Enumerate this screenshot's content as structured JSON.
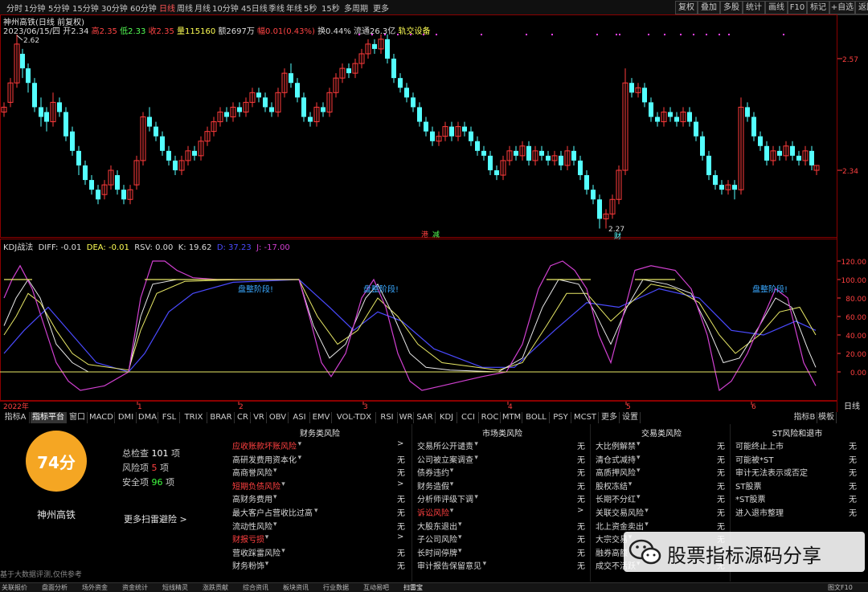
{
  "periods": [
    "分时",
    "1分钟",
    "5分钟",
    "15分钟",
    "30分钟",
    "60分钟",
    "日线",
    "周线",
    "月线",
    "10分钟",
    "45日线",
    "季线",
    "年线",
    "5秒",
    "15秒",
    "多周期",
    "更多"
  ],
  "active_period": "日线",
  "toolbar": [
    "复权",
    "叠加",
    "多股",
    "统计",
    "画线",
    "F10",
    "标记",
    "+自选",
    "返回"
  ],
  "stock": {
    "title": "神州高铁(日线 前复权)",
    "info_date": "2023/06/15/四",
    "open": "开2.34",
    "high": "高2.35",
    "low": "低2.33",
    "close": "收2.35",
    "volume": "量115160",
    "amount": "额2697万",
    "change": "幅0.01(0.43%)",
    "turnover": "换0.44%",
    "float": "流通26.3亿",
    "sector": "轨交设备"
  },
  "price_axis": {
    "upper": "2.57",
    "lower": "2.34"
  },
  "price_annotations": {
    "high": "2.62",
    "low": "2.27",
    "low_note": "财"
  },
  "chart_marks": {
    "m1": "港",
    "m2": "减"
  },
  "kdj": {
    "title": "KDJ战法",
    "diff": "DIFF: -0.01",
    "dea": "DEA: -0.01",
    "rsv": "RSV: 0.00",
    "k": "K: 19.62",
    "d": "D: 37.23",
    "j": "J: -17.00",
    "axis_labels": [
      "120.00",
      "100.00",
      "80.00",
      "60.00",
      "40.00",
      "20.00",
      "0.00"
    ],
    "note": "盘整阶段!"
  },
  "xaxis": {
    "year": "2022年",
    "months": [
      "1",
      "2",
      "3",
      "4",
      "5",
      "6"
    ],
    "period_label": "日线"
  },
  "indicator_tabs": [
    "指标A",
    "指标平台",
    "窗口",
    "MACD",
    "DMI",
    "DMA",
    "FSL",
    "TRIX",
    "BRAR",
    "CR",
    "VR",
    "OBV",
    "ASI",
    "EMV",
    "VOL-TDX",
    "RSI",
    "WR",
    "SAR",
    "KDJ",
    "CCI",
    "ROC",
    "MTM",
    "BOLL",
    "PSY",
    "MCST",
    "更多",
    "设置"
  ],
  "right_tabs": [
    "指标B",
    "模板"
  ],
  "risk": {
    "score": "74分",
    "name": "神州高铁",
    "total_label": "总检查",
    "total_value": "101",
    "total_unit": "项",
    "risk_label": "风险项",
    "risk_value": "5",
    "risk_unit": "项",
    "safe_label": "安全项",
    "safe_value": "96",
    "safe_unit": "项",
    "more": "更多扫雷避险 >",
    "disclaimer": "基于大数据评测,仅供参考",
    "columns": [
      {
        "title": "财务类风险",
        "items": [
          {
            "label": "应收账款坏账风险",
            "value": ">",
            "warn": true
          },
          {
            "label": "高研发费用资本化",
            "value": "无",
            "warn": false
          },
          {
            "label": "高商誉风险",
            "value": "无",
            "warn": false
          },
          {
            "label": "短期负债风险",
            "value": ">",
            "warn": true
          },
          {
            "label": "高财务费用",
            "value": "无",
            "warn": false
          },
          {
            "label": "最大客户占营收比过高",
            "value": "无",
            "warn": false
          },
          {
            "label": "流动性风险",
            "value": "无",
            "warn": false
          },
          {
            "label": "财报亏损",
            "value": ">",
            "warn": true
          },
          {
            "label": "营收踩雷风险",
            "value": "无",
            "warn": false
          },
          {
            "label": "财务粉饰",
            "value": "无",
            "warn": false
          }
        ]
      },
      {
        "title": "市场类风险",
        "items": [
          {
            "label": "交易所公开谴责",
            "value": "无",
            "warn": false
          },
          {
            "label": "公司被立案调查",
            "value": "无",
            "warn": false
          },
          {
            "label": "债券违约",
            "value": "无",
            "warn": false
          },
          {
            "label": "财务造假",
            "value": "无",
            "warn": false
          },
          {
            "label": "分析师评级下调",
            "value": "无",
            "warn": false
          },
          {
            "label": "诉讼风险",
            "value": ">",
            "warn": true
          },
          {
            "label": "大股东退出",
            "value": "无",
            "warn": false
          },
          {
            "label": "子公司风险",
            "value": "无",
            "warn": false
          },
          {
            "label": "长时间停牌",
            "value": "无",
            "warn": false
          },
          {
            "label": "审计报告保留意见",
            "value": "无",
            "warn": false
          }
        ]
      },
      {
        "title": "交易类风险",
        "items": [
          {
            "label": "大比例解禁",
            "value": "无",
            "warn": false
          },
          {
            "label": "清仓式减持",
            "value": "无",
            "warn": false
          },
          {
            "label": "高质押风险",
            "value": "无",
            "warn": false
          },
          {
            "label": "股权冻结",
            "value": "无",
            "warn": false
          },
          {
            "label": "长期不分红",
            "value": "无",
            "warn": false
          },
          {
            "label": "关联交易风险",
            "value": "无",
            "warn": false
          },
          {
            "label": "北上资金卖出",
            "value": "无",
            "warn": false
          },
          {
            "label": "大宗交易",
            "value": "无",
            "warn": false
          },
          {
            "label": "融券高额",
            "value": "无",
            "warn": false
          },
          {
            "label": "成交不活跃",
            "value": "无",
            "warn": false
          }
        ]
      },
      {
        "title": "ST风险和退市",
        "items": [
          {
            "label": "可能终止上市",
            "value": "无",
            "warn": false
          },
          {
            "label": "可能被*ST",
            "value": "无",
            "warn": false
          },
          {
            "label": "审计无法表示或否定",
            "value": "无",
            "warn": false
          },
          {
            "label": "ST股票",
            "value": "无",
            "warn": false
          },
          {
            "label": "*ST股票",
            "value": "无",
            "warn": false
          },
          {
            "label": "进入退市整理",
            "value": "无",
            "warn": false
          }
        ]
      }
    ]
  },
  "watermark": "股票指标源码分享",
  "bottom_tabs": [
    "关联报价",
    "盘面分析",
    "场外资金",
    "资金统计",
    "短线精灵",
    "涨跌贡献",
    "综合资讯",
    "板块资讯",
    "行业数据",
    "互动易吧",
    "扫雷宝"
  ],
  "bottom_right": "图文F10",
  "colors": {
    "up": "#ff3b3b",
    "down": "#54ffff",
    "k": "#e8e8e8",
    "d": "#e8e866",
    "j": "#d040d0",
    "blue": "#4a4aff",
    "accent": "#f5a623",
    "warn": "#ff4040"
  }
}
